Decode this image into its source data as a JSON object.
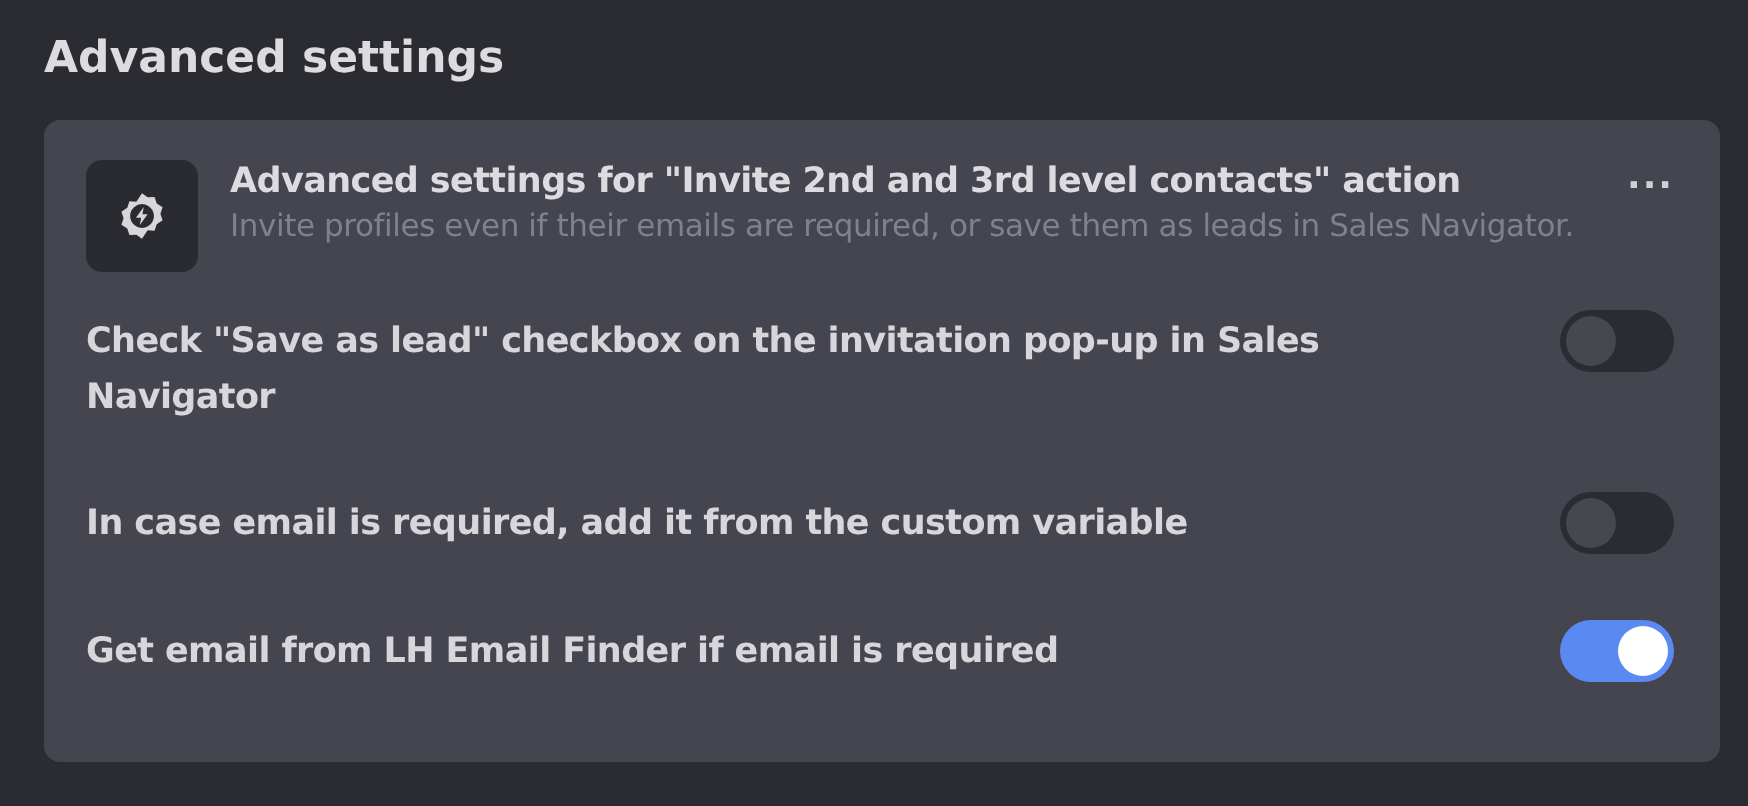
{
  "page_title": "Advanced settings",
  "panel": {
    "title": "Advanced settings for \"Invite 2nd and 3rd level contacts\" action",
    "description": "Invite profiles even if their emails are required, or save them as leads in Sales Navigator.",
    "menu": "..."
  },
  "settings": [
    {
      "label": "Check \"Save as lead\" checkbox on the invitation pop-up in Sales Navigator",
      "on": false
    },
    {
      "label": "In case email is required, add it from the custom variable",
      "on": false
    },
    {
      "label": "Get email from LH Email Finder if email is required",
      "on": true
    }
  ]
}
